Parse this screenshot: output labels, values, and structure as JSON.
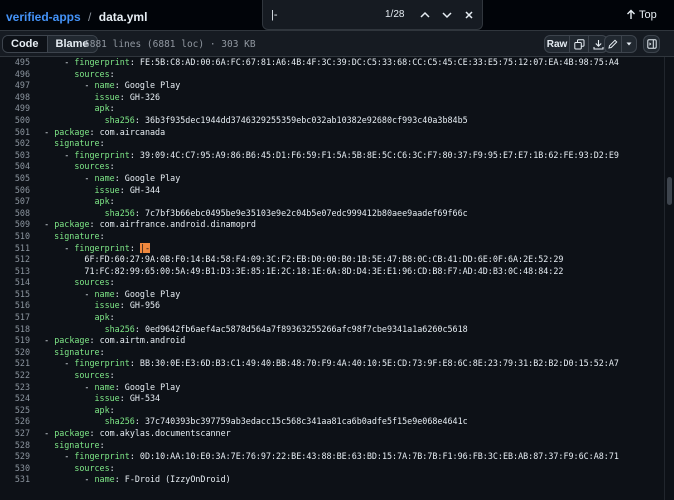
{
  "breadcrumb": {
    "repo": "verified-apps",
    "separator": "/",
    "file": "data.yml"
  },
  "find": {
    "value": "|-",
    "count": "1/28"
  },
  "top_button": {
    "label": "Top"
  },
  "view_toggle": {
    "code": "Code",
    "blame": "Blame"
  },
  "file_meta": "6881 lines (6881 loc) · 303 KB",
  "toolbar": {
    "raw": "Raw"
  },
  "colors": {
    "background": "#0d1117",
    "key": "#7ee787",
    "text": "#e6edf3",
    "line_number": "#8b949e",
    "link": "#4493f8",
    "cursor": "#f0883e"
  },
  "lines": [
    {
      "n": "495",
      "indent": "      ",
      "dash": "- ",
      "key": "fingerprint",
      "sep": ": ",
      "value": "FE:5B:C8:AD:00:6A:FC:67:81:A6:4B:4F:3C:39:DC:C5:33:68:CC:C5:45:CE:33:E5:75:12:07:EA:4B:98:75:A4"
    },
    {
      "n": "496",
      "indent": "        ",
      "dash": "",
      "key": "sources",
      "sep": ":",
      "value": ""
    },
    {
      "n": "497",
      "indent": "          ",
      "dash": "- ",
      "key": "name",
      "sep": ": ",
      "value": "Google Play"
    },
    {
      "n": "498",
      "indent": "            ",
      "dash": "",
      "key": "issue",
      "sep": ": ",
      "value": "GH-326"
    },
    {
      "n": "499",
      "indent": "            ",
      "dash": "",
      "key": "apk",
      "sep": ":",
      "value": ""
    },
    {
      "n": "500",
      "indent": "              ",
      "dash": "",
      "key": "sha256",
      "sep": ": ",
      "value": "36b3f935dec1944dd3746329255359ebc032ab10382e92680cf993c40a3b84b5"
    },
    {
      "n": "501",
      "indent": "  ",
      "dash": "- ",
      "key": "package",
      "sep": ": ",
      "value": "com.aircanada"
    },
    {
      "n": "502",
      "indent": "    ",
      "dash": "",
      "key": "signature",
      "sep": ":",
      "value": ""
    },
    {
      "n": "503",
      "indent": "      ",
      "dash": "- ",
      "key": "fingerprint",
      "sep": ": ",
      "value": "39:09:4C:C7:95:A9:86:B6:45:D1:F6:59:F1:5A:5B:8E:5C:C6:3C:F7:80:37:F9:95:E7:E7:1B:62:FE:93:D2:E9"
    },
    {
      "n": "504",
      "indent": "        ",
      "dash": "",
      "key": "sources",
      "sep": ":",
      "value": ""
    },
    {
      "n": "505",
      "indent": "          ",
      "dash": "- ",
      "key": "name",
      "sep": ": ",
      "value": "Google Play"
    },
    {
      "n": "506",
      "indent": "            ",
      "dash": "",
      "key": "issue",
      "sep": ": ",
      "value": "GH-344"
    },
    {
      "n": "507",
      "indent": "            ",
      "dash": "",
      "key": "apk",
      "sep": ":",
      "value": ""
    },
    {
      "n": "508",
      "indent": "              ",
      "dash": "",
      "key": "sha256",
      "sep": ": ",
      "value": "7c7bf3b66ebc0495be9e35103e9e2c04b5e07edc999412b80aee9aadef69f66c"
    },
    {
      "n": "509",
      "indent": "  ",
      "dash": "- ",
      "key": "package",
      "sep": ": ",
      "value": "com.airfrance.android.dinamoprd"
    },
    {
      "n": "510",
      "indent": "    ",
      "dash": "",
      "key": "signature",
      "sep": ":",
      "value": ""
    },
    {
      "n": "511",
      "indent": "      ",
      "dash": "- ",
      "key": "fingerprint",
      "sep": ": ",
      "value": "",
      "marker": "|-"
    },
    {
      "n": "512",
      "indent": "          ",
      "dash": "",
      "key": "",
      "sep": "",
      "value": "6F:FD:60:27:9A:0B:F0:14:B4:58:F4:09:3C:F2:EB:D0:00:B0:1B:5E:47:B8:0C:CB:41:DD:6E:0F:6A:2E:52:29"
    },
    {
      "n": "513",
      "indent": "          ",
      "dash": "",
      "key": "",
      "sep": "",
      "value": "71:FC:82:99:65:00:5A:49:B1:D3:3E:85:1E:2C:18:1E:6A:8D:D4:3E:E1:96:CD:B8:F7:AD:4D:B3:0C:48:84:22"
    },
    {
      "n": "514",
      "indent": "        ",
      "dash": "",
      "key": "sources",
      "sep": ":",
      "value": ""
    },
    {
      "n": "515",
      "indent": "          ",
      "dash": "- ",
      "key": "name",
      "sep": ": ",
      "value": "Google Play"
    },
    {
      "n": "516",
      "indent": "            ",
      "dash": "",
      "key": "issue",
      "sep": ": ",
      "value": "GH-956"
    },
    {
      "n": "517",
      "indent": "            ",
      "dash": "",
      "key": "apk",
      "sep": ":",
      "value": ""
    },
    {
      "n": "518",
      "indent": "              ",
      "dash": "",
      "key": "sha256",
      "sep": ": ",
      "value": "0ed9642fb6aef4ac5878d564a7f89363255266afc98f7cbe9341a1a6260c5618"
    },
    {
      "n": "519",
      "indent": "  ",
      "dash": "- ",
      "key": "package",
      "sep": ": ",
      "value": "com.airtm.android"
    },
    {
      "n": "520",
      "indent": "    ",
      "dash": "",
      "key": "signature",
      "sep": ":",
      "value": ""
    },
    {
      "n": "521",
      "indent": "      ",
      "dash": "- ",
      "key": "fingerprint",
      "sep": ": ",
      "value": "BB:30:0E:E3:6D:B3:C1:49:40:BB:48:70:F9:4A:40:10:5E:CD:73:9F:E8:6C:8E:23:79:31:B2:B2:D0:15:52:A7"
    },
    {
      "n": "522",
      "indent": "        ",
      "dash": "",
      "key": "sources",
      "sep": ":",
      "value": ""
    },
    {
      "n": "523",
      "indent": "          ",
      "dash": "- ",
      "key": "name",
      "sep": ": ",
      "value": "Google Play"
    },
    {
      "n": "524",
      "indent": "            ",
      "dash": "",
      "key": "issue",
      "sep": ": ",
      "value": "GH-534"
    },
    {
      "n": "525",
      "indent": "            ",
      "dash": "",
      "key": "apk",
      "sep": ":",
      "value": ""
    },
    {
      "n": "526",
      "indent": "              ",
      "dash": "",
      "key": "sha256",
      "sep": ": ",
      "value": "37c740393bc397759ab3edacc15c568c341aa81ca6b0adfe5f15e9e068e4641c"
    },
    {
      "n": "527",
      "indent": "  ",
      "dash": "- ",
      "key": "package",
      "sep": ": ",
      "value": "com.akylas.documentscanner"
    },
    {
      "n": "528",
      "indent": "    ",
      "dash": "",
      "key": "signature",
      "sep": ":",
      "value": ""
    },
    {
      "n": "529",
      "indent": "      ",
      "dash": "- ",
      "key": "fingerprint",
      "sep": ": ",
      "value": "0D:10:AA:10:E0:3A:7E:76:97:22:BE:43:88:BE:63:BD:15:7A:7B:7B:F1:96:FB:3C:EB:AB:87:37:F9:6C:A8:71"
    },
    {
      "n": "530",
      "indent": "        ",
      "dash": "",
      "key": "sources",
      "sep": ":",
      "value": ""
    },
    {
      "n": "531",
      "indent": "          ",
      "dash": "- ",
      "key": "name",
      "sep": ": ",
      "value": "F-Droid (IzzyOnDroid)"
    }
  ]
}
